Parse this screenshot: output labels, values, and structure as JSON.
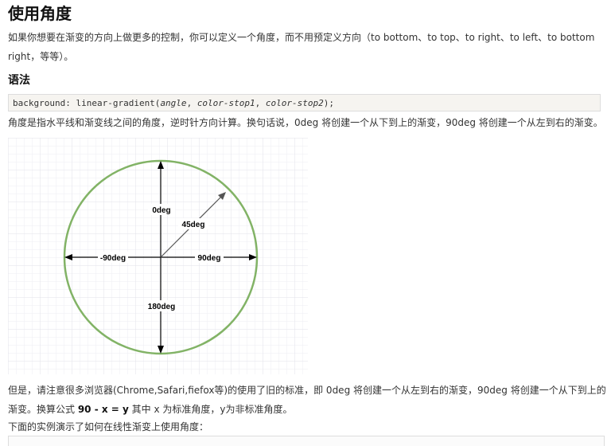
{
  "title": "使用角度",
  "intro": "如果你想要在渐变的方向上做更多的控制，你可以定义一个角度，而不用预定义方向（to bottom、to top、to right、to left、to bottom right，等等）。",
  "syntax_heading": "语法",
  "code": {
    "prefix": "background: linear-gradient(",
    "param1": "angle",
    "sep1": ", ",
    "param2": "color-stop1",
    "sep2": ", ",
    "param3": "color-stop2",
    "suffix": ");"
  },
  "angle_desc": "角度是指水平线和渐变线之间的角度，逆时针方向计算。换句话说，0deg 将创建一个从下到上的渐变，90deg 将创建一个从左到右的渐变。",
  "diagram": {
    "labels": {
      "top": "0deg",
      "diag": "45deg",
      "left": "-90deg",
      "right": "90deg",
      "bottom": "180deg"
    },
    "colors": {
      "circle": "#82b366",
      "grid": "#e8e8ee",
      "arrow": "#000000",
      "diag_arrow": "#333333"
    }
  },
  "note": {
    "part1": "但是，请注意很多浏览器(Chrome,Safari,fiefox等)的使用了旧的标准，即 0deg 将创建一个从左到右的渐变，90deg 将创建一个从下到上的渐变。换算公式 ",
    "formula": "90 - x = y",
    "part2": " 其中 x 为标准角度，y为非标准角度。"
  },
  "example_intro": "下面的实例演示了如何在线性渐变上使用角度："
}
